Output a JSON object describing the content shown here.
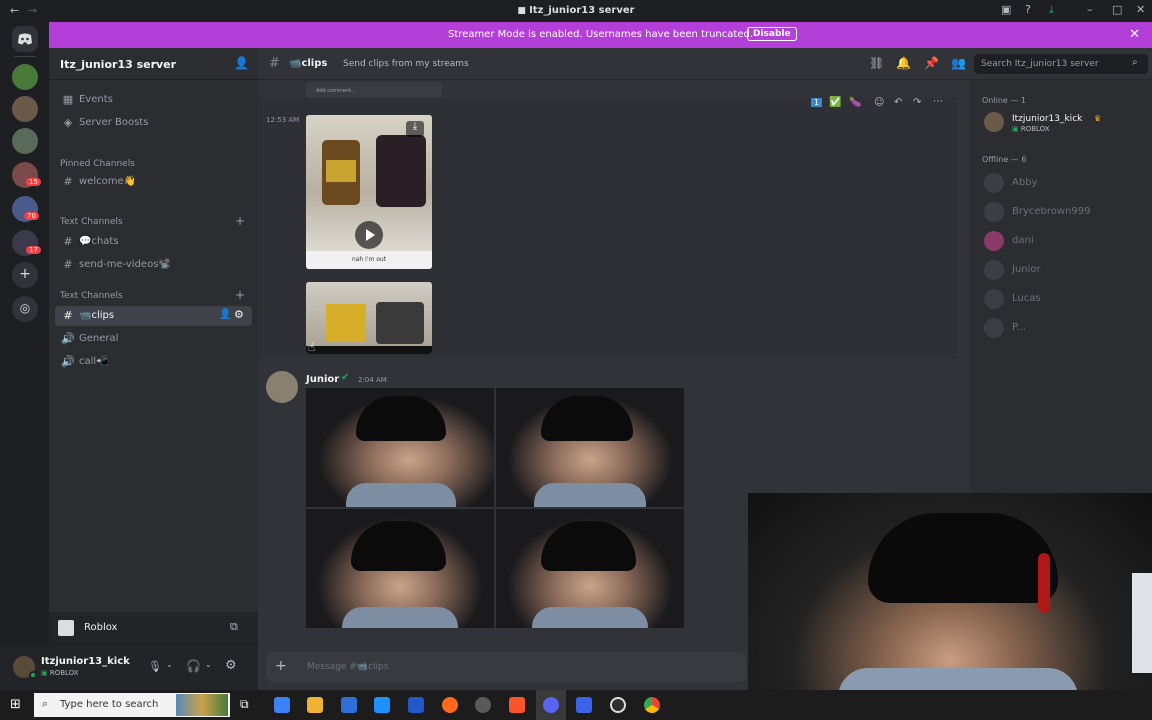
{
  "window": {
    "title": "Itz_junior13 server"
  },
  "banner": {
    "message": "Streamer Mode is enabled. Usernames have been truncated.",
    "button": "Disable"
  },
  "server": {
    "name": "Itz_junior13 server"
  },
  "sidebar": {
    "events": "Events",
    "boosts": "Server Boosts",
    "pinned_category": "Pinned Channels",
    "welcome": "welcome👋",
    "text_category_1": "Text Channels",
    "chats": "💬chats",
    "send_videos": "send-me-videos📽️",
    "text_category_2": "Text Channels",
    "clips": "📹clips",
    "general": "General",
    "call": "call📲"
  },
  "server_badges": [
    "15",
    "70",
    "17"
  ],
  "activity": {
    "name": "Roblox"
  },
  "user": {
    "name": "Itzjunior13_kick",
    "status": "ROBLOX"
  },
  "channel": {
    "name": "📹clips",
    "topic": "Send clips from my streams",
    "search_placeholder": "Search Itz_junior13 server"
  },
  "messages": [
    {
      "time": "12:53 AM",
      "video_caption": "nah i'm out",
      "video_preview_top": "Add comment..."
    },
    {
      "author": "Junior",
      "time": "2:04 AM"
    }
  ],
  "composer": {
    "placeholder": "Message #📹clips"
  },
  "members": {
    "online_header": "Online — 1",
    "online": [
      {
        "name": "Itzjunior13_kick",
        "status": "ROBLOX"
      }
    ],
    "offline_header": "Offline — 6",
    "offline": [
      "Abby",
      "Brycebrown999",
      "dani",
      "Junior",
      "Lucas",
      "P..."
    ]
  },
  "taskbar": {
    "search_placeholder": "Type here to search"
  },
  "colors": {
    "brand": "#5865f2",
    "banner": "#b33fd8",
    "online": "#23a55a"
  }
}
